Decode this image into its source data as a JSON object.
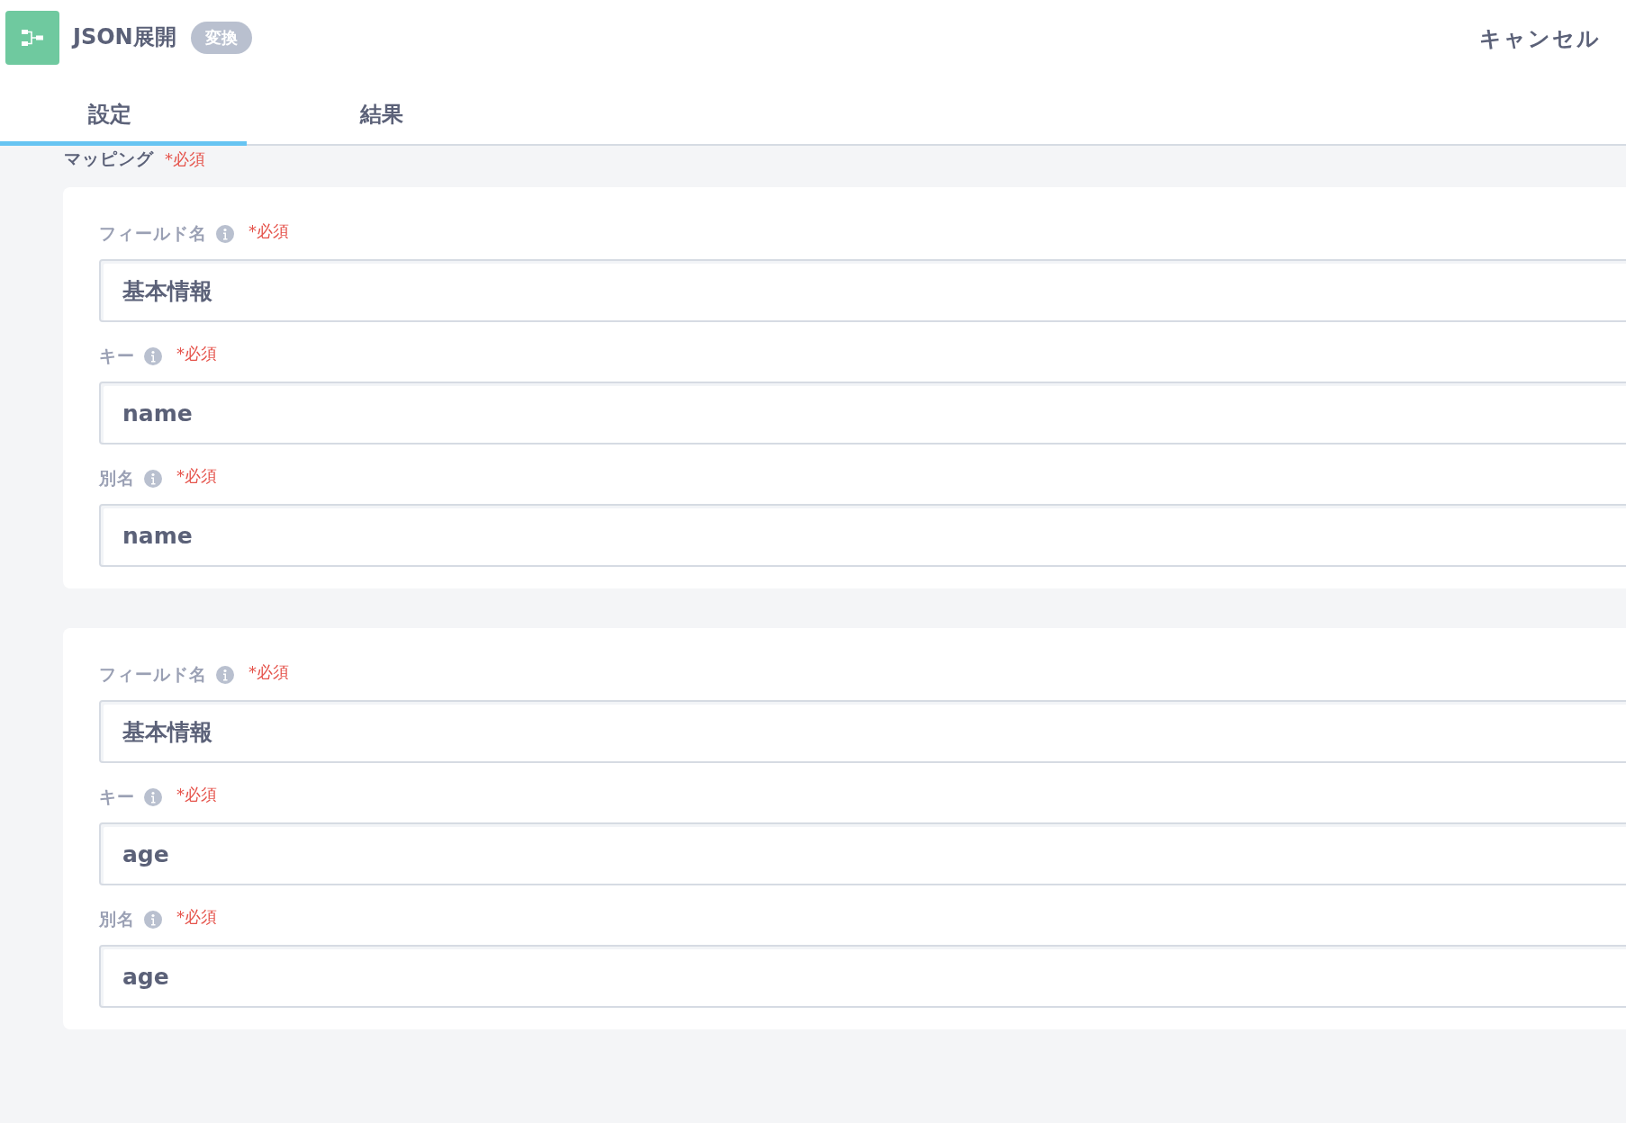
{
  "header": {
    "title": "JSON展開",
    "badge": "変換",
    "cancel": "キャンセル"
  },
  "tabs": [
    {
      "label": "設定",
      "selected": true
    },
    {
      "label": "結果",
      "selected": false
    }
  ],
  "mapping": {
    "label": "マッピング",
    "required": "*必須",
    "entries": [
      {
        "fields": [
          {
            "label": "フィールド名",
            "required": "*必須",
            "value": "基本情報"
          },
          {
            "label": "キー",
            "required": "*必須",
            "value": "name"
          },
          {
            "label": "別名",
            "required": "*必須",
            "value": "name"
          }
        ]
      },
      {
        "fields": [
          {
            "label": "フィールド名",
            "required": "*必須",
            "value": "基本情報"
          },
          {
            "label": "キー",
            "required": "*必須",
            "value": "age"
          },
          {
            "label": "別名",
            "required": "*必須",
            "value": "age"
          }
        ]
      }
    ]
  }
}
